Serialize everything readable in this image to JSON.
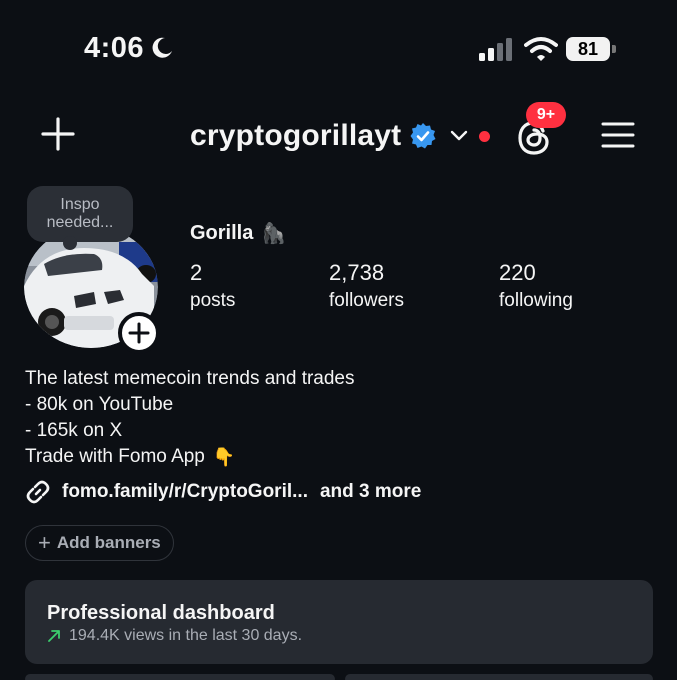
{
  "status_bar": {
    "time": "4:06",
    "battery": "81",
    "icons": [
      "moon-icon",
      "signal-icon",
      "wifi-icon",
      "battery-icon"
    ]
  },
  "header": {
    "username": "cryptogorillayt",
    "notification_badge": "9+",
    "icons": [
      "plus-icon",
      "verified-icon",
      "chevron-down-icon",
      "threads-icon",
      "menu-icon"
    ],
    "colors": {
      "verified": "#3897f0",
      "badge": "#ff3040",
      "dot": "#ff3040"
    }
  },
  "profile": {
    "note": "Inspo needed...",
    "display_name": "Gorilla",
    "display_name_emoji": "🦍",
    "stats": [
      {
        "value": "2",
        "label": "posts"
      },
      {
        "value": "2,738",
        "label": "followers"
      },
      {
        "value": "220",
        "label": "following"
      }
    ]
  },
  "bio": {
    "lines": [
      "The latest memecoin trends and trades",
      "- 80k on YouTube",
      "- 165k on X",
      "Trade with Fomo App"
    ],
    "line4_emoji": "👇",
    "link": "fomo.family/r/CryptoGoril...",
    "link_more": "and 3 more"
  },
  "add_banners": {
    "label": "Add banners"
  },
  "dashboard": {
    "title": "Professional dashboard",
    "subtitle": "194.4K views in the last 30 days.",
    "accent": "#3ccf6e"
  }
}
